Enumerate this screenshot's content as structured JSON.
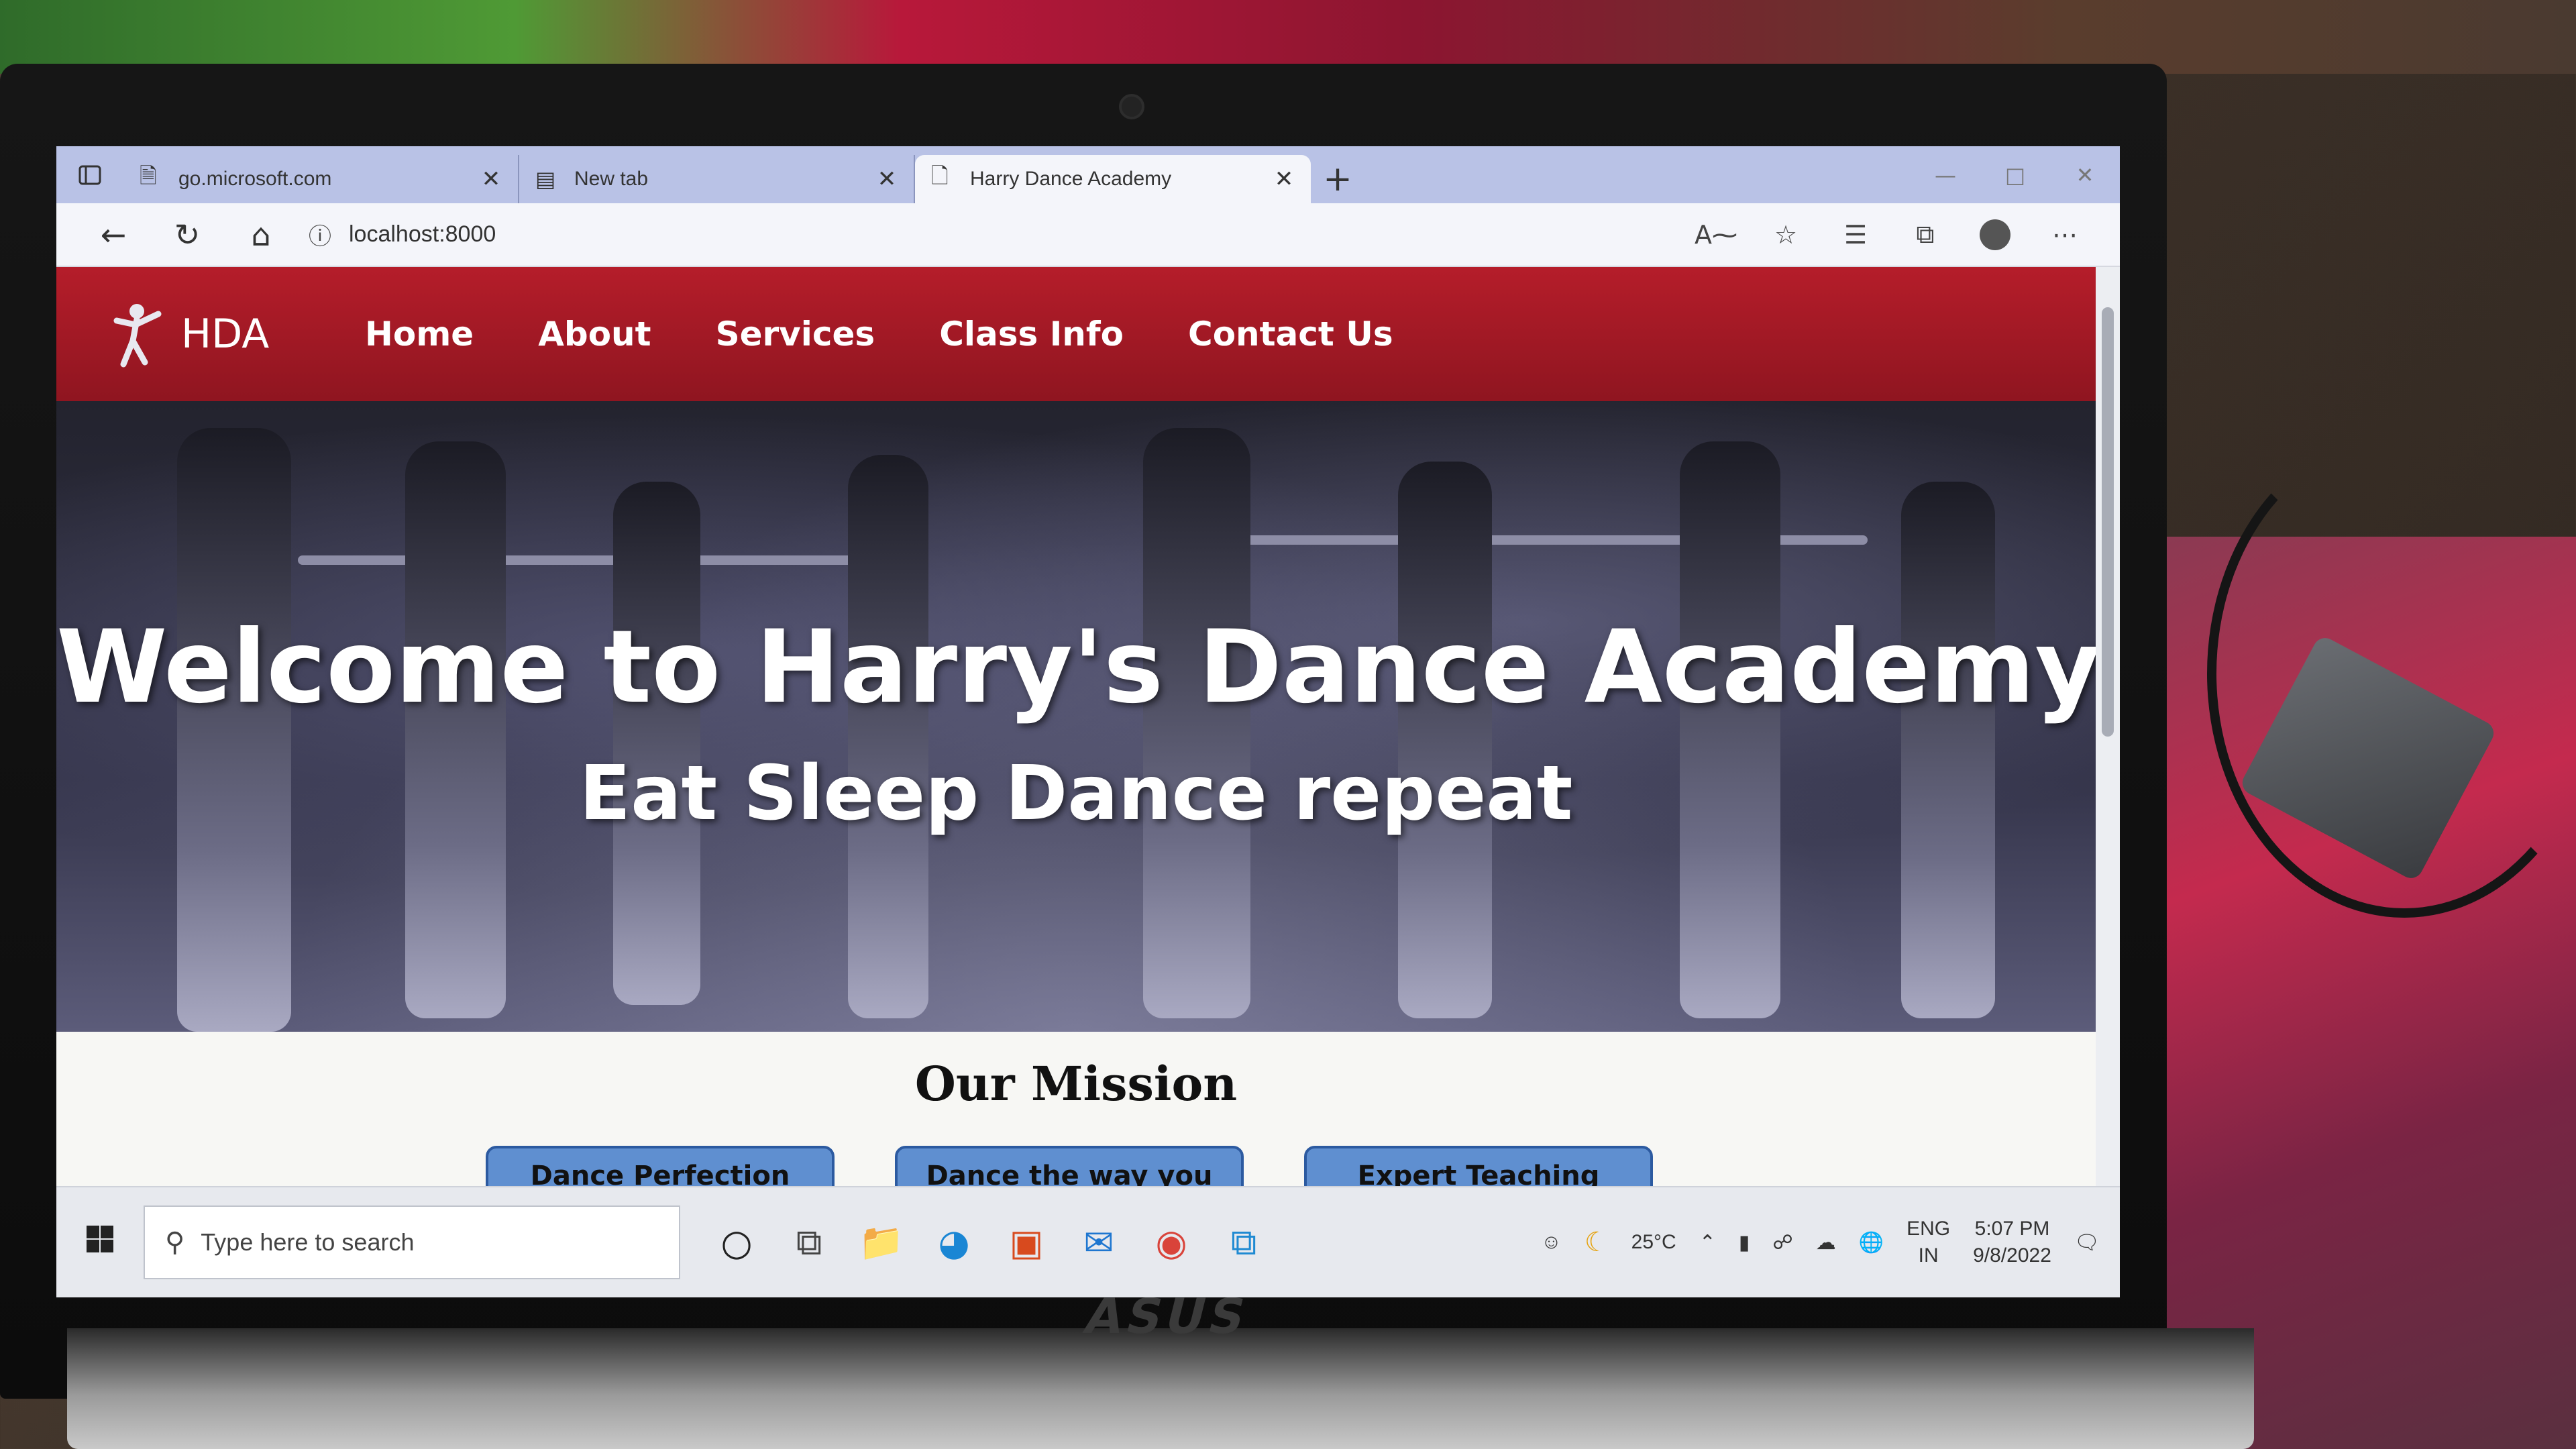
{
  "browser": {
    "tabs": [
      {
        "title": "go.microsoft.com",
        "active": false
      },
      {
        "title": "New tab",
        "active": false
      },
      {
        "title": "Harry Dance Academy",
        "active": true
      }
    ],
    "new_tab_label": "+",
    "address": "localhost:8000"
  },
  "site": {
    "logo_text": "HDA",
    "nav": [
      "Home",
      "About",
      "Services",
      "Class Info",
      "Contact Us"
    ],
    "hero_title": "Welcome to Harry's Dance Academy",
    "hero_subtitle": "Eat Sleep Dance repeat",
    "mission_heading": "Our Mission",
    "mission_cards": [
      "Dance Perfection",
      "Dance the way you like",
      "Expert Teaching"
    ],
    "colors": {
      "nav_bg": "#a81a26",
      "card_bg": "#5f8fd0",
      "browser_tabstrip": "#b9c2e6"
    }
  },
  "taskbar": {
    "search_placeholder": "Type here to search",
    "temperature": "25°C",
    "language_top": "ENG",
    "language_bottom": "IN",
    "time": "5:07 PM",
    "date": "9/8/2022"
  },
  "laptop": {
    "brand": "ASUS"
  }
}
